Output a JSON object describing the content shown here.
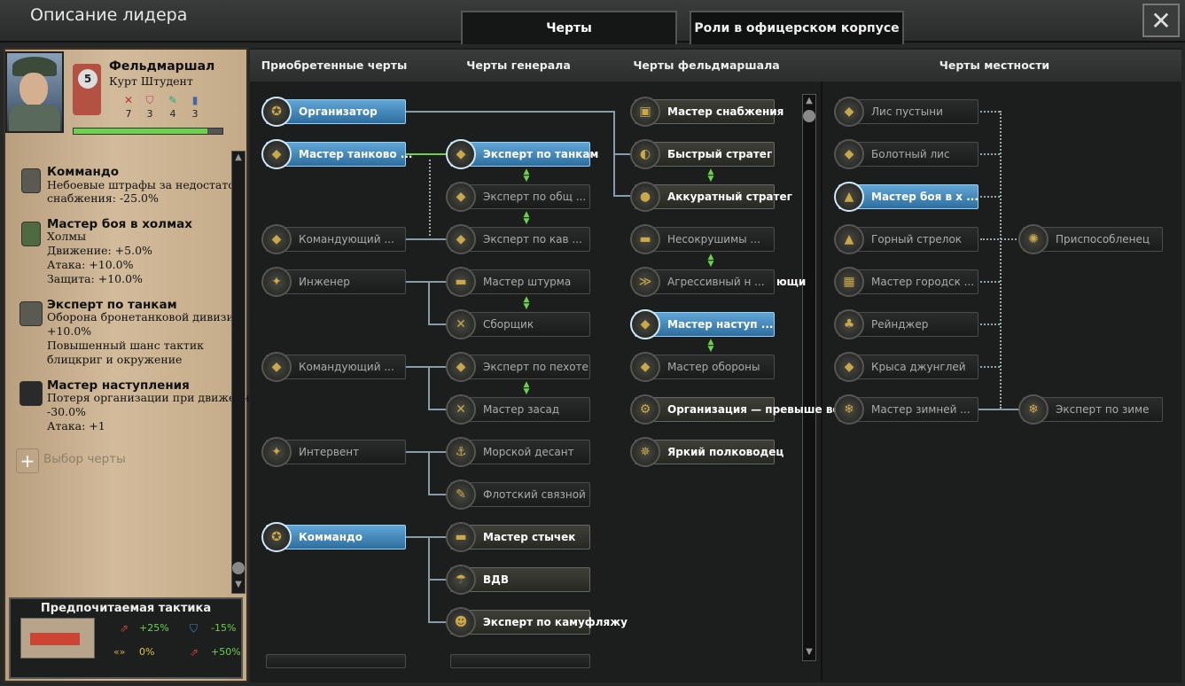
{
  "window": {
    "title": "Описание лидера",
    "close": "✕"
  },
  "tabs": [
    {
      "label": "Черты"
    },
    {
      "label": "Роли в офицерском корпусе"
    }
  ],
  "leader": {
    "rank": "Фельдмаршал",
    "name": "Курт Штудент",
    "level": "5",
    "stats": {
      "attack": "7",
      "defense": "3",
      "planning": "4",
      "logistics": "3"
    },
    "xp_fraction": 0.9
  },
  "leader_traits": [
    {
      "name": "Коммандо",
      "lines": [
        "Небоевые штрафы за недостаток",
        "снабжения: -25.0%"
      ]
    },
    {
      "name": "Мастер боя в холмах",
      "lines": [
        "Холмы",
        "Движение:  +5.0%",
        "Атака:  +10.0%",
        "Защита:  +10.0%"
      ]
    },
    {
      "name": "Эксперт по танкам",
      "lines": [
        "Оборона бронетанковой дивизии:",
        "+10.0%",
        "Повышенный шанс тактик",
        "блицкриг и окружение"
      ]
    },
    {
      "name": "Мастер наступления",
      "lines": [
        "Потеря организации при движении:",
        "-30.0%",
        "Атака: +1"
      ]
    }
  ],
  "add_trait": "Выбор черты",
  "tactic": {
    "title": "Предпочитаемая тактика",
    "mods": [
      "+25%",
      "-15%",
      "0%",
      "+50%"
    ]
  },
  "columns": [
    "Приобретенные черты",
    "Черты генерала",
    "Черты фельдмаршала",
    "Черты местности"
  ],
  "traits": {
    "acquired": [
      "Организатор",
      "Мастер танково ...",
      "Командующий ...",
      "Инженер",
      "Командующий ...",
      "Интервент",
      "Коммандо"
    ],
    "general": [
      "Эксперт по танкам",
      "Эксперт по общ ...",
      "Эксперт по кав ...",
      "Мастер штурма",
      "Сборщик",
      "Эксперт по пехоте",
      "Мастер засад",
      "Морской десант",
      "Флотский связной",
      "Мастер стычек",
      "ВДВ",
      "Эксперт по камуфляжу"
    ],
    "field_marshal": [
      "Мастер снабжения",
      "Быстрый стратег",
      "Аккуратный стратег",
      "Несокрушимы ...",
      "Агрессивный н ...",
      "Мастер наступ ...",
      "Мастер обороны",
      "Организация — превыше всего",
      "Яркий полководец"
    ],
    "terrain": [
      "Лис пустыни",
      "Болотный лис",
      "Мастер боя в х ...",
      "Горный стрелок",
      "Мастер городск ...",
      "Рейнджер",
      "Крыса джунглей",
      "Мастер зимней ...",
      "Приспособленец",
      "Эксперт по зиме"
    ]
  },
  "overflow_text": "ющи",
  "colors": {
    "active": "#3a84ba",
    "green": "#6cd24a",
    "panel": "#c9b08e"
  }
}
